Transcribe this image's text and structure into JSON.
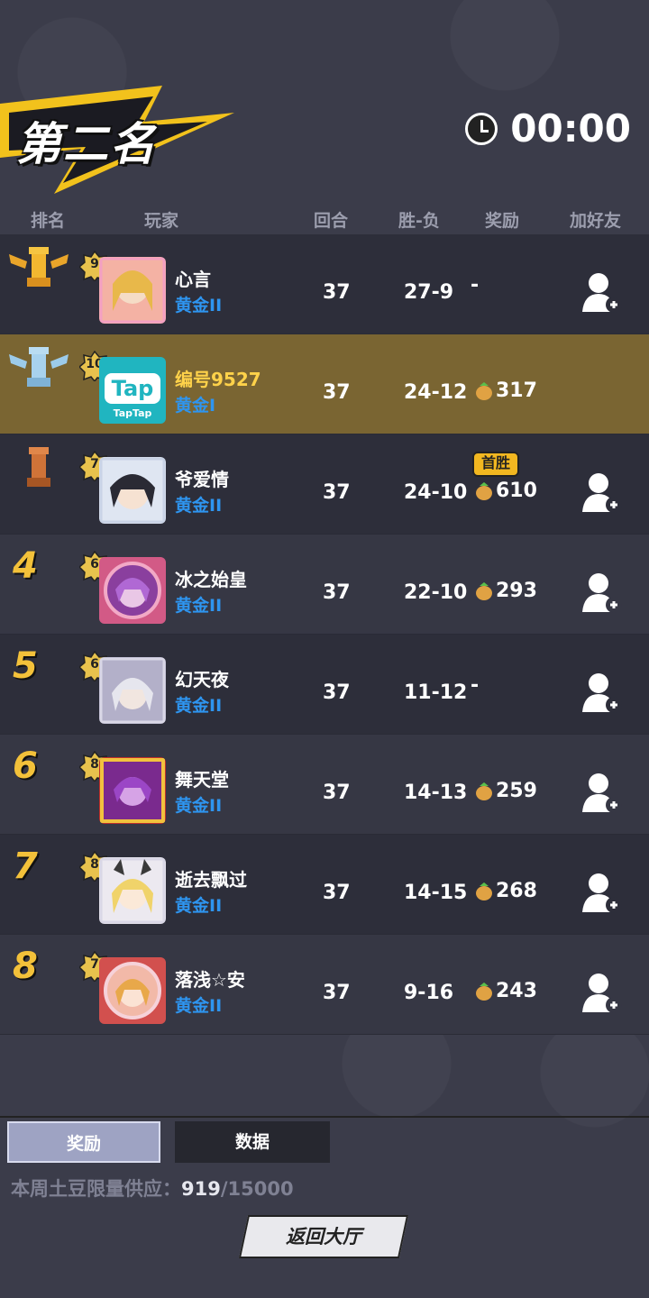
{
  "header": {
    "title": "第二名",
    "timer": "00:00"
  },
  "columns": {
    "rank": "排名",
    "player": "玩家",
    "rounds": "回合",
    "winloss": "胜-负",
    "reward": "奖励",
    "add_friend": "加好友"
  },
  "rows": [
    {
      "rank": "1",
      "level": "9",
      "name": "心言",
      "tier": "黄金II",
      "rounds": "37",
      "winloss": "27-9",
      "reward": "-"
    },
    {
      "rank": "2",
      "level": "10",
      "name": "编号9527",
      "tier": "黄金I",
      "rounds": "37",
      "winloss": "24-12",
      "reward": "317"
    },
    {
      "rank": "3",
      "level": "7",
      "name": "爷爱情",
      "tier": "黄金II",
      "rounds": "37",
      "winloss": "24-10",
      "reward": "610",
      "badge": "首胜"
    },
    {
      "rank": "4",
      "level": "6",
      "name": "冰之始皇",
      "tier": "黄金II",
      "rounds": "37",
      "winloss": "22-10",
      "reward": "293"
    },
    {
      "rank": "5",
      "level": "6",
      "name": "幻天夜",
      "tier": "黄金II",
      "rounds": "37",
      "winloss": "11-12",
      "reward": "-"
    },
    {
      "rank": "6",
      "level": "8",
      "name": "舞天堂",
      "tier": "黄金II",
      "rounds": "37",
      "winloss": "14-13",
      "reward": "259"
    },
    {
      "rank": "7",
      "level": "8",
      "name": "逝去飘过",
      "tier": "黄金II",
      "rounds": "37",
      "winloss": "14-15",
      "reward": "268"
    },
    {
      "rank": "8",
      "level": "7",
      "name": "落浅☆安",
      "tier": "黄金II",
      "rounds": "37",
      "winloss": "9-16",
      "reward": "243"
    }
  ],
  "avatar_tap": {
    "big": "Tap",
    "small": "TapTap"
  },
  "tabs": {
    "reward": "奖励",
    "data": "数据"
  },
  "supply": {
    "label": "本周土豆限量供应：",
    "current": "919",
    "total": "/15000"
  },
  "back_button": "返回大厅",
  "colors": {
    "gold": "#f3c13a",
    "tier_blue": "#2e95f0",
    "highlight_row": "#7a6532"
  }
}
